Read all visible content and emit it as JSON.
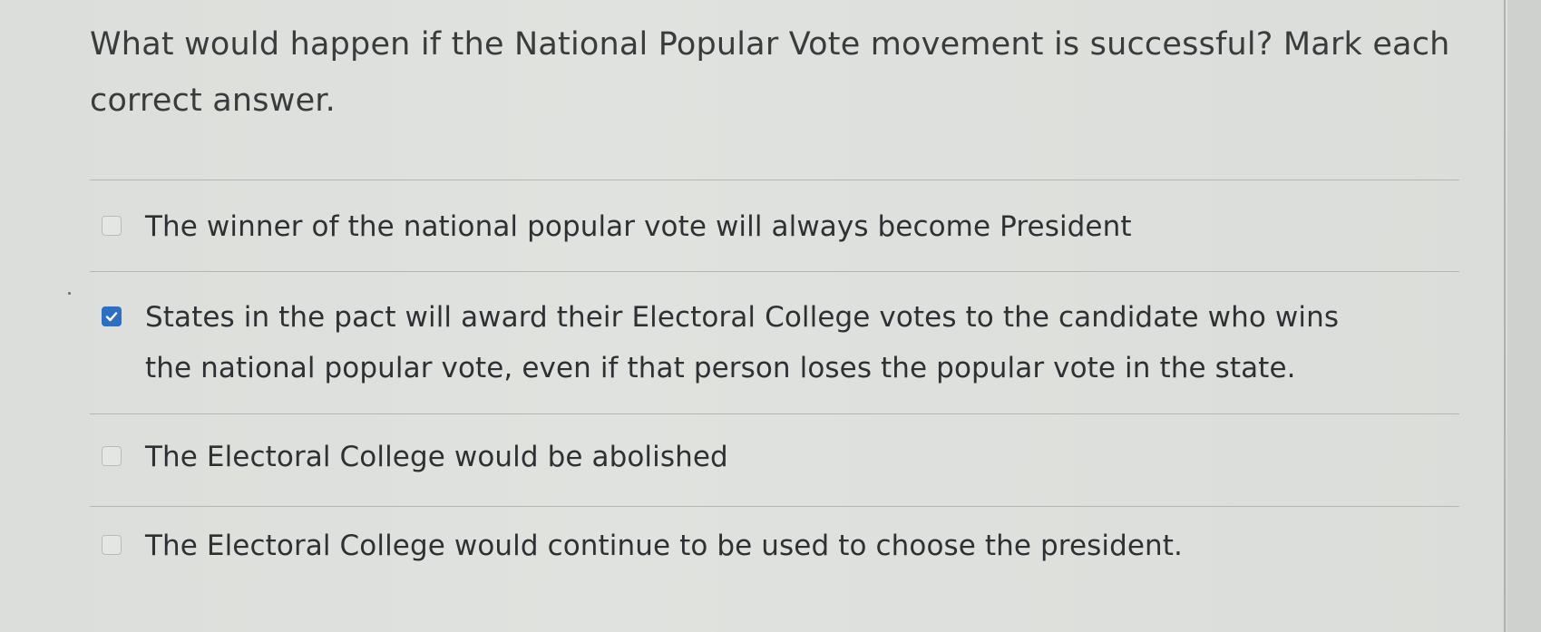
{
  "question": {
    "text": "What would happen if the National Popular Vote movement is successful? Mark each correct answer."
  },
  "answers": [
    {
      "text": "The winner of the national popular vote will always become President",
      "checked": false
    },
    {
      "text": "States in the pact will award their Electoral College votes to the candidate who wins the national popular vote, even if that person loses the popular vote in the state.",
      "checked": true
    },
    {
      "text": "The Electoral College would be abolished",
      "checked": false
    },
    {
      "text": "The Electoral College would continue to be used to choose the president.",
      "checked": false
    }
  ],
  "colors": {
    "checked_accent": "#2d6fc2",
    "text": "#2f3033"
  }
}
